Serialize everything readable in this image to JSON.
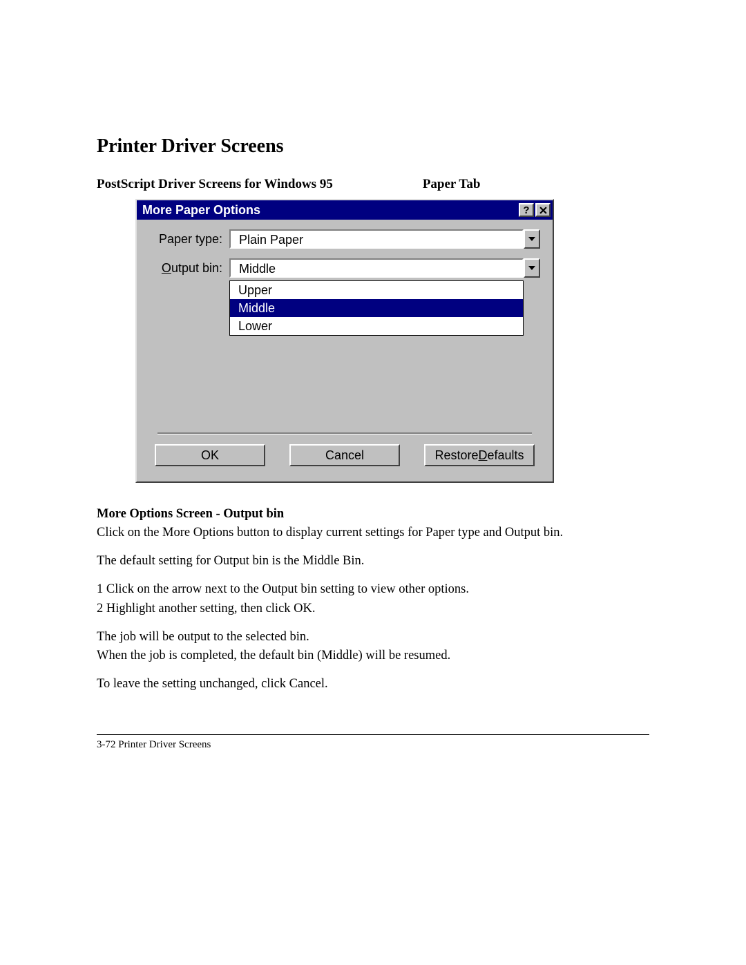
{
  "heading": "Printer Driver Screens",
  "subhead_left": "PostScript Driver Screens for Windows 95",
  "subhead_right": "Paper Tab",
  "dialog": {
    "title": "More Paper Options",
    "paper_type_label": "Paper type:",
    "paper_type_value": "Plain Paper",
    "output_bin_label_prefix": "O",
    "output_bin_label_rest": "utput bin:",
    "output_bin_value": "Middle",
    "options": {
      "0": "Upper",
      "1": "Middle",
      "2": "Lower"
    },
    "ok_label": "OK",
    "cancel_label": "Cancel",
    "restore_prefix": "Restore ",
    "restore_ul": "D",
    "restore_rest": "efaults"
  },
  "body": {
    "caption": "More Options Screen - Output bin",
    "p1": "Click on the More Options button to display current settings for Paper type and Output bin.",
    "p2": "The default setting for Output bin is the Middle Bin.",
    "p3": "1 Click on the arrow next to the Output bin setting to view other options.",
    "p4": "2 Highlight another setting, then click OK.",
    "p5": "The job will be output to the selected bin.",
    "p6": "When the job is completed, the default bin (Middle) will be resumed.",
    "p7": "To leave the setting unchanged, click Cancel."
  },
  "footer": "3-72 Printer Driver Screens"
}
